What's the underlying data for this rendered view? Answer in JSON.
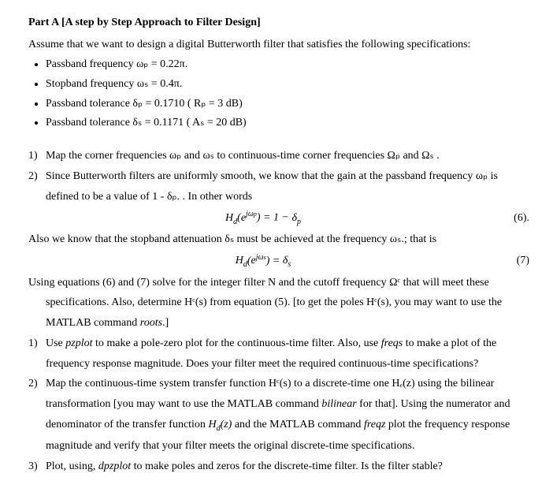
{
  "title": "Part A [A step by Step Approach to Filter Design]",
  "intro": "Assume that we want to design a digital Butterworth filter that satisfies the following specifications:",
  "specs": {
    "b1": "Passband frequency ωₚ = 0.22π.",
    "b2": "Stopband frequency ωₛ = 0.4π.",
    "b3": "Passband tolerance δₚ = 0.1710 ( Rₚ = 3 dB)",
    "b4": "Passband tolerance δₛ = 0.1171 ( Aₛ = 20 dB)"
  },
  "steps_a": {
    "s1": "Map the corner frequencies ωₚ and ωₛ to continuous-time corner frequencies Ωₚ and Ωₛ .",
    "s2a": "Since Butterworth filters are uniformly smooth, we know that the gain at the passband frequency ωₚ is",
    "s2b": "defined to be a value of 1 - δₚ. . In other words"
  },
  "eq6": {
    "expr": "Hₑ(eʲᵚᵖ) = 1 − δₚ",
    "num": "(6)."
  },
  "mid1": "Also we know that the stopband attenuation δₛ must be achieved at the frequency ωₛ.; that is",
  "eq7": {
    "expr": "Hₑ(eʲᵚˢ) = δₛ",
    "num": "(7)"
  },
  "using_a": "Using equations (6) and (7) solve for the integer filter N and the cutoff frequency Ωᶜ that will meet these",
  "using_b": "specifications. Also, determine Hᶜ(s) from equation (5). [to get the poles Hᶜ(s), you may want to use the",
  "using_c": "MATLAB command roots.]",
  "steps_b": {
    "s1a": "Use pzplot to make a pole-zero plot for the continuous-time filter. Also, use freqs to make a plot of the",
    "s1b": "frequency response magnitude. Does your filter meet the required continuous-time specifications?",
    "s2a": "Map the continuous-time system transfer function Hᶜ(s) to a discrete-time one Hₑ(z) using the bilinear",
    "s2b": "transformation [you may want to use the MATLAB command bilinear for that]. Using the numerator and",
    "s2c": "denominator of the transfer function Hₑ(z) and the MATLAB command freqz plot the frequency response",
    "s2d": "magnitude and verify that your filter meets the original discrete-time specifications.",
    "s3": "Plot, using, dpzplot to make poles and zeros for the discrete-time filter. Is the filter stable?"
  }
}
